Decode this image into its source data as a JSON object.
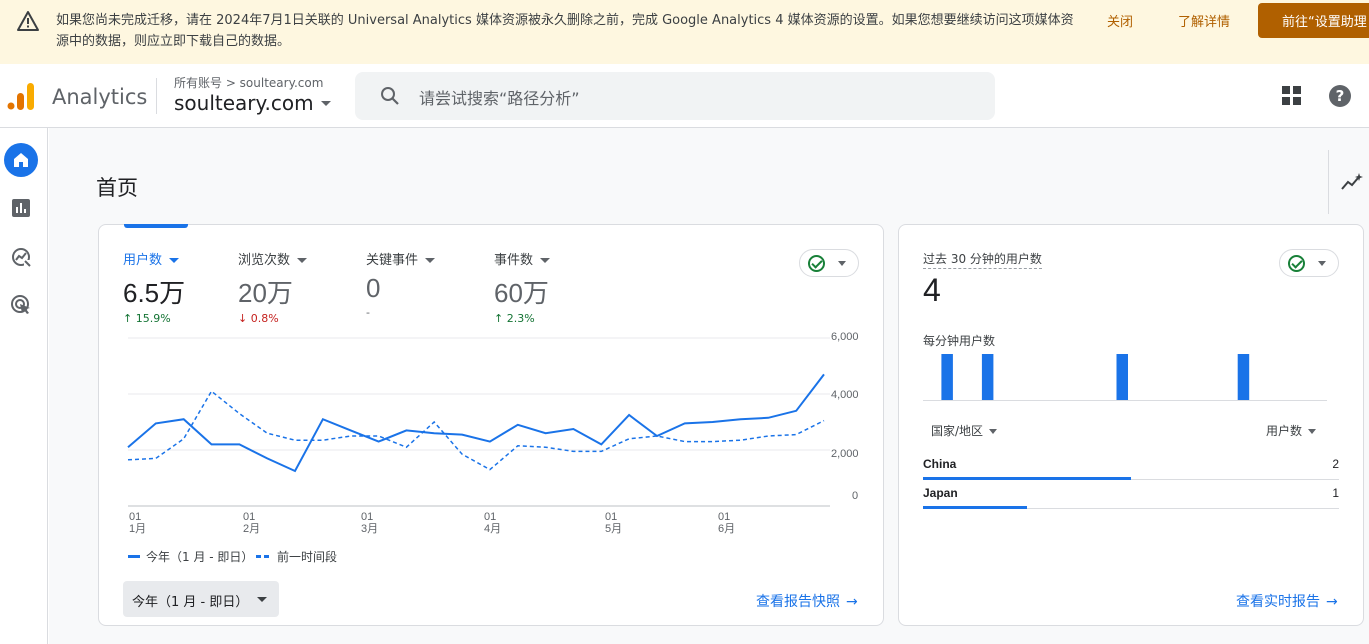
{
  "banner": {
    "message": "如果您尚未完成迁移，请在 2024年7月1日关联的 Universal Analytics 媒体资源被永久删除之前，完成 Google Analytics 4 媒体资源的设置。如果您想要继续访问这项媒体资源中的数据，则应立即下载自己的数据。",
    "close_label": "关闭",
    "learn_more_label": "了解详情",
    "go_label": "前往“设置助理"
  },
  "header": {
    "app_name": "Analytics",
    "breadcrumb": "所有账号 > soulteary.com",
    "property": "soulteary.com",
    "search_placeholder": "请尝试搜索“路径分析”"
  },
  "page": {
    "title": "首页"
  },
  "metrics": [
    {
      "label": "用户数",
      "value": "6.5万",
      "delta": "15.9%",
      "direction": "up"
    },
    {
      "label": "浏览次数",
      "value": "20万",
      "delta": "0.8%",
      "direction": "down"
    },
    {
      "label": "关键事件",
      "value": "0",
      "delta": "-",
      "direction": "none"
    },
    {
      "label": "事件数",
      "value": "60万",
      "delta": "2.3%",
      "direction": "up"
    }
  ],
  "arrows": {
    "up": "↑",
    "down": "↓"
  },
  "chart_data": {
    "type": "line",
    "y_ticks": [
      "6,000",
      "4,000",
      "2,000",
      "0"
    ],
    "ylim": [
      0,
      6000
    ],
    "x_ticks": [
      {
        "day": "01",
        "month": "1月"
      },
      {
        "day": "01",
        "month": "2月"
      },
      {
        "day": "01",
        "month": "3月"
      },
      {
        "day": "01",
        "month": "4月"
      },
      {
        "day": "01",
        "month": "5月"
      },
      {
        "day": "01",
        "month": "6月"
      }
    ],
    "series": [
      {
        "name": "今年（1 月 - 即日）",
        "style": "solid",
        "values": [
          2100,
          2950,
          3100,
          2200,
          2200,
          1700,
          1250,
          3100,
          2700,
          2300,
          2700,
          2600,
          2550,
          2300,
          2900,
          2600,
          2750,
          2200,
          3250,
          2500,
          2950,
          3000,
          3100,
          3150,
          3400,
          4700
        ]
      },
      {
        "name": "前一时间段",
        "style": "dashed",
        "values": [
          1650,
          1700,
          2400,
          4100,
          3300,
          2600,
          2350,
          2350,
          2500,
          2500,
          2100,
          3000,
          1850,
          1300,
          2150,
          2100,
          1950,
          1950,
          2400,
          2500,
          2300,
          2300,
          2350,
          2500,
          2550,
          3050
        ]
      }
    ]
  },
  "legend": {
    "current": "今年（1 月 - 即日）",
    "previous": "前一时间段"
  },
  "date_range": "今年（1 月 - 即日）",
  "report_link": "查看报告快照",
  "realtime": {
    "title": "过去 30 分钟的用户数",
    "value": "4",
    "per_minute_label": "每分钟用户数",
    "per_minute_values": [
      0,
      1,
      0,
      0,
      1,
      0,
      0,
      0,
      0,
      0,
      0,
      0,
      0,
      0,
      1,
      0,
      0,
      0,
      0,
      0,
      0,
      0,
      0,
      1,
      0,
      0,
      0,
      0,
      0,
      0
    ],
    "col_country": "国家/地区",
    "col_users": "用户数",
    "rows": [
      {
        "country": "China",
        "users": "2",
        "share": 1.0
      },
      {
        "country": "Japan",
        "users": "1",
        "share": 0.5
      }
    ],
    "link": "查看实时报告"
  },
  "colors": {
    "accent": "#1a73e8",
    "up": "#137333",
    "down": "#c5221f",
    "banner_button": "#b06000"
  }
}
